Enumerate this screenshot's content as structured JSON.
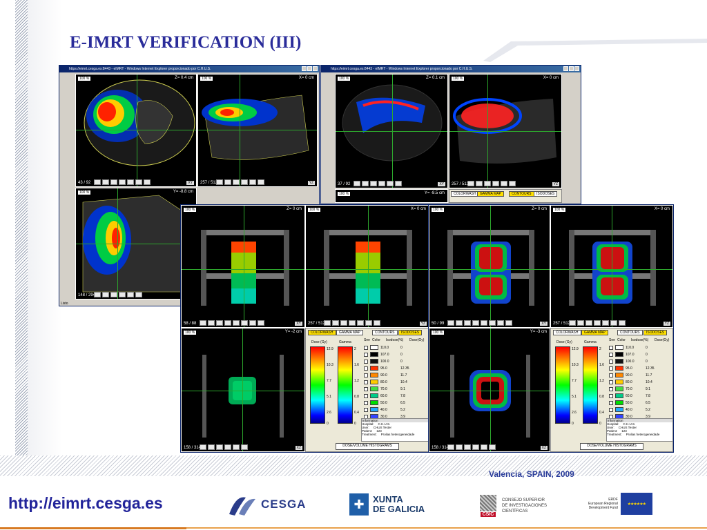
{
  "slide": {
    "title": "E-IMRT VERIFICATION (III)",
    "url": "http://eimrt.cesga.es",
    "location": "Valencia, SPAIN, 2009"
  },
  "logos": {
    "cesga": "CESGA",
    "xunta": "XUNTA\nDE GALICIA",
    "csic_line1": "CONSEJO SUPERIOR",
    "csic_line2": "DE INVESTIGACIONES",
    "csic_line3": "CIENTÍFICAS",
    "csic_badge": "CSIC",
    "erdf_line1": "ERDF",
    "erdf_line2": "European Regional",
    "erdf_line3": "Development Fund"
  },
  "windows": {
    "left_title": "https://eimrt.cesga.es:8443 - eIMRT - Windows Internet Explorer proporcionado por C.H.U.S.",
    "right_title": "https://eimrt.cesga.es:8443 - eIMRT - Windows Internet Explorer proporcionado por C.H.U.S.",
    "statusbar": "Listo"
  },
  "panels": {
    "tl_a": {
      "label": "Z= 0.4 cm",
      "count": "43 / 92",
      "axis": "XY"
    },
    "tl_b": {
      "label": "X= 0 cm",
      "count": "257 / 512",
      "axis": "YZ"
    },
    "tl_c": {
      "label": "Y= -8.8 cm",
      "count": "148 / 294",
      "axis": ""
    },
    "tr_a": {
      "label": "Z= 0.1 cm",
      "count": "37 / 92",
      "axis": "XY"
    },
    "tr_b": {
      "label": "X= 0 cm",
      "count": "257 / 512",
      "axis": "YZ"
    },
    "tr_c": {
      "label": "Y= -8.5 cm"
    },
    "f1_a": {
      "label": "Z= 0 cm",
      "count": "58 / 88",
      "axis": "XY"
    },
    "f1_b": {
      "label": "X= 0 cm",
      "count": "257 / 512",
      "axis": "YZ"
    },
    "f1_c": {
      "label": "Y= -2 cm",
      "count": "158 / 314",
      "axis": "XZ"
    },
    "f2_a": {
      "label": "Z= 0 cm",
      "count": "50 / 99",
      "axis": "XY"
    },
    "f2_b": {
      "label": "X= 0 cm",
      "count": "257 / 512",
      "axis": "YZ"
    },
    "f2_c": {
      "label": "Y= -3 cm",
      "count": "158 / 314",
      "axis": "XZ"
    },
    "zoom": "100 %"
  },
  "controls": {
    "tab_colorwash": "COLORWASH",
    "tab_gamma": "GAMMA MAP",
    "tab_contours": "CONTOURS",
    "tab_isodoses": "ISODOSES",
    "dose_label": "Dose (Gy)",
    "gamma_label": "Gamma",
    "dose_ticks": [
      "12.9",
      "10.3",
      "7.7",
      "5.1",
      "2.6",
      "0"
    ],
    "gamma_ticks": [
      "2",
      "1.6",
      "1.2",
      "0.8",
      "0.4",
      "0"
    ],
    "col_see": "See",
    "col_color": "Color",
    "col_isodose": "Isodose(%)",
    "col_dose": "Dose(Gy)",
    "col_organ": "Organ",
    "col_type": "Type",
    "organ_body": "Body",
    "isodoses": [
      {
        "pct": "110.0",
        "gy": "0"
      },
      {
        "pct": "107.0",
        "gy": "0"
      },
      {
        "pct": "100.0",
        "gy": "0"
      },
      {
        "pct": "95.0",
        "gy": "12.35"
      },
      {
        "pct": "90.0",
        "gy": "11.7"
      },
      {
        "pct": "80.0",
        "gy": "10.4"
      },
      {
        "pct": "70.0",
        "gy": "9.1"
      },
      {
        "pct": "60.0",
        "gy": "7.8"
      },
      {
        "pct": "50.0",
        "gy": "6.5"
      },
      {
        "pct": "40.0",
        "gy": "5.2"
      },
      {
        "pct": "30.0",
        "gy": "3.9"
      }
    ],
    "info_title": "Information",
    "info_hospital_k": "Hospital:",
    "info_hospital_v": "C.H.U.S.",
    "info_user_k": "User:",
    "info_user_v": "CHUS Tester",
    "info_patient_k": "Patient:",
    "info_patient_v": "123",
    "info_treatment_k": "Treatment:",
    "info_treatment_v": "Prolias heterogeneidade",
    "dvh_button": "DOSE/VOLUME HISTOGRAMS"
  },
  "colors": {
    "title": "#2a2c9a",
    "url": "#22249a",
    "accent_orange": "#e8a04a",
    "grid_green": "#2da82d"
  }
}
